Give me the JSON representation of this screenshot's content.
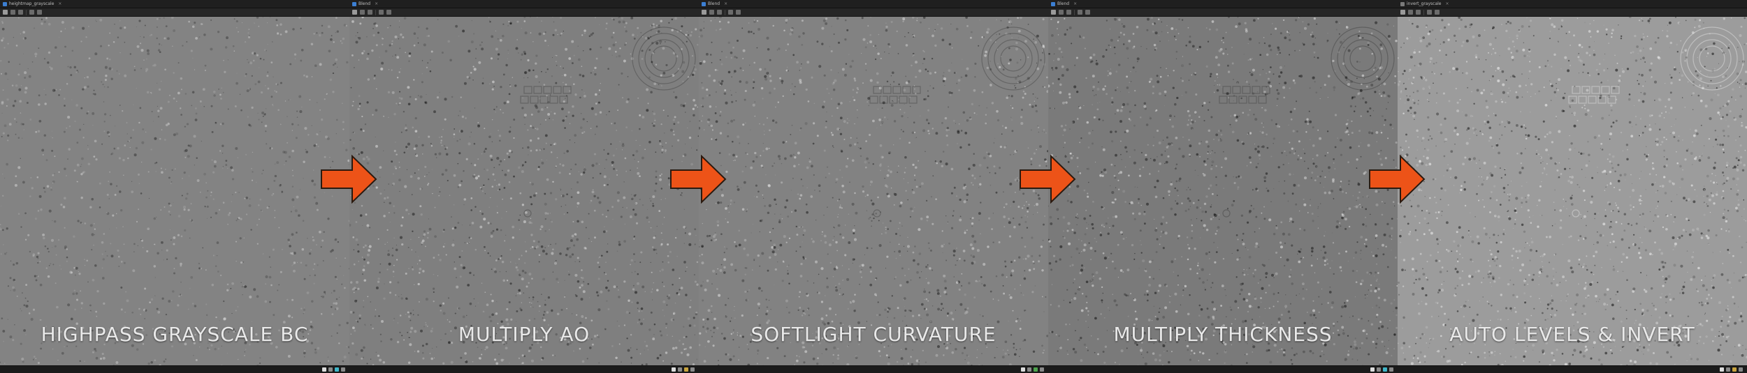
{
  "colors": {
    "arrow_fill": "#ed5318",
    "arrow_stroke": "#2a1a10",
    "caption_text": "#e9e9e9"
  },
  "panels": [
    {
      "caption": "HIGHPASS GRAYSCALE BC",
      "tab_title": "heightmap_grayscale",
      "base_gray": "#838383",
      "speckle_strength": 0.25
    },
    {
      "caption": "MULTIPLY AO",
      "tab_title": "Blend",
      "base_gray": "#7f7f7f",
      "speckle_strength": 0.55
    },
    {
      "caption": "SOFTLIGHT CURVATURE",
      "tab_title": "Blend",
      "base_gray": "#828282",
      "speckle_strength": 0.5
    },
    {
      "caption": "MULTIPLY THICKNESS",
      "tab_title": "Blend",
      "base_gray": "#7a7a7a",
      "speckle_strength": 0.6
    },
    {
      "caption": "AUTO LEVELS & INVERT",
      "tab_title": "invert_grayscale",
      "base_gray": "#9c9c9c",
      "speckle_strength": 0.7
    }
  ],
  "icons": {
    "arrow": "arrow-right-icon",
    "tab_node": "node-icon",
    "close": "close-icon"
  }
}
